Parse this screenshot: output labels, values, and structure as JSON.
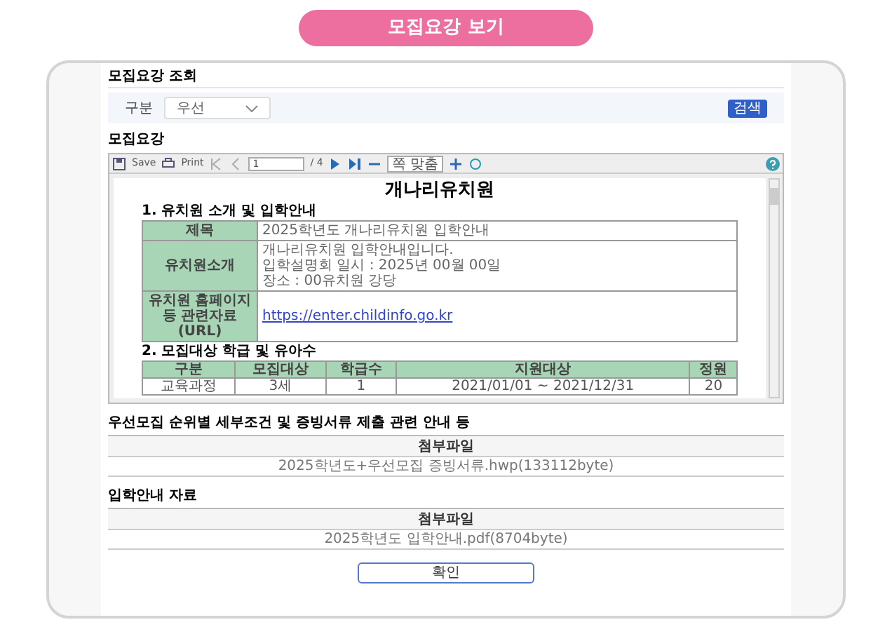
{
  "header": {
    "title": "모집요강 보기"
  },
  "inquiry": {
    "title": "모집요강 조회",
    "filter_label": "구분",
    "filter_value": "우선",
    "search_button": "검색"
  },
  "guide": {
    "title": "모집요강",
    "toolbar": {
      "save": "Save",
      "print": "Print",
      "page": "1",
      "total": "/ 4",
      "zoom": "쪽 맞춤"
    },
    "document": {
      "title": "개나리유치원",
      "section1": {
        "heading": "1. 유치원 소개 및 입학안내",
        "rows": [
          {
            "kind": "text",
            "label": "제목",
            "lines": [
              "2025학년도 개나리유치원 입학안내"
            ]
          },
          {
            "kind": "text",
            "label": "유치원소개",
            "lines": [
              "개나리유치원 입학안내입니다.",
              "입학설명회 일시 : 2025년 00월 00일",
              "장소 : 00유치원 강당"
            ]
          },
          {
            "kind": "link",
            "label": "유치원 홈페이지 등 관련자료(URL)",
            "lines": [
              "https://enter.childinfo.go.kr"
            ]
          }
        ]
      },
      "section2": {
        "heading": "2. 모집대상 학급 및 유아수",
        "columns": [
          "구분",
          "모집대상",
          "학급수",
          "지원대상",
          "정원"
        ],
        "rows": [
          [
            "교육과정",
            "3세",
            "1",
            "2021/01/01 ~ 2021/12/31",
            "20"
          ]
        ]
      }
    }
  },
  "attachments": [
    {
      "title": "우선모집 순위별 세부조건 및 증빙서류 제출 관련 안내 등",
      "column": "첨부파일",
      "file": "2025학년도+우선모집 증빙서류.hwp(133112byte)"
    },
    {
      "title": "입학안내 자료",
      "column": "첨부파일",
      "file": "2025학년도 입학안내.pdf(8704byte)"
    }
  ],
  "confirm_button": "확인"
}
